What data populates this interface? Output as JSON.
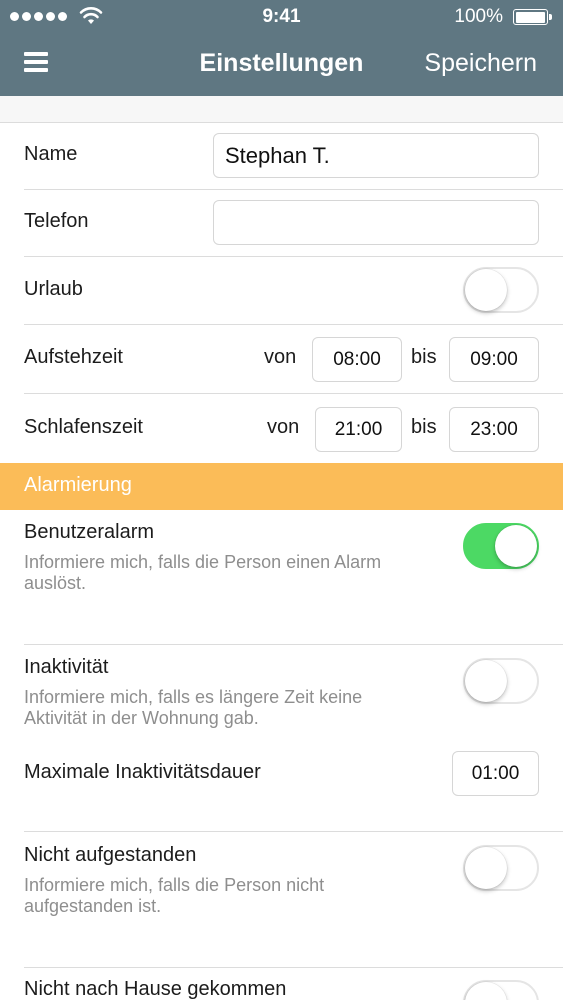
{
  "status_bar": {
    "time": "9:41",
    "battery": "100%"
  },
  "nav": {
    "title": "Einstellungen",
    "save_label": "Speichern"
  },
  "settings": {
    "name": {
      "label": "Name",
      "value": "Stephan T."
    },
    "phone": {
      "label": "Telefon",
      "value": ""
    },
    "vacation": {
      "label": "Urlaub",
      "enabled": false
    },
    "wakeup": {
      "label": "Aufstehzeit",
      "from_label": "von",
      "from": "08:00",
      "to_label": "bis",
      "to": "09:00"
    },
    "sleep": {
      "label": "Schlafenszeit",
      "from_label": "von",
      "from": "21:00",
      "to_label": "bis",
      "to": "23:00"
    }
  },
  "alarm_section": {
    "title": "Alarmierung",
    "user_alarm": {
      "label": "Benutzeralarm",
      "description": "Informiere mich, falls die Person einen Alarm auslöst.",
      "enabled": true
    },
    "inactivity": {
      "label": "Inaktivität",
      "description": "Informiere mich, falls es längere Zeit keine Aktivität in der Wohnung gab.",
      "enabled": false
    },
    "max_inactivity": {
      "label": "Maximale Inaktivitätsdauer",
      "value": "01:00"
    },
    "not_up": {
      "label": "Nicht aufgestanden",
      "description": "Informiere mich, falls die Person nicht aufgestanden ist.",
      "enabled": false
    },
    "not_home": {
      "label": "Nicht nach Hause gekommen",
      "enabled": false
    }
  },
  "colors": {
    "header": "#5f7782",
    "section": "#fbbc58",
    "toggle_on": "#4cd964"
  }
}
